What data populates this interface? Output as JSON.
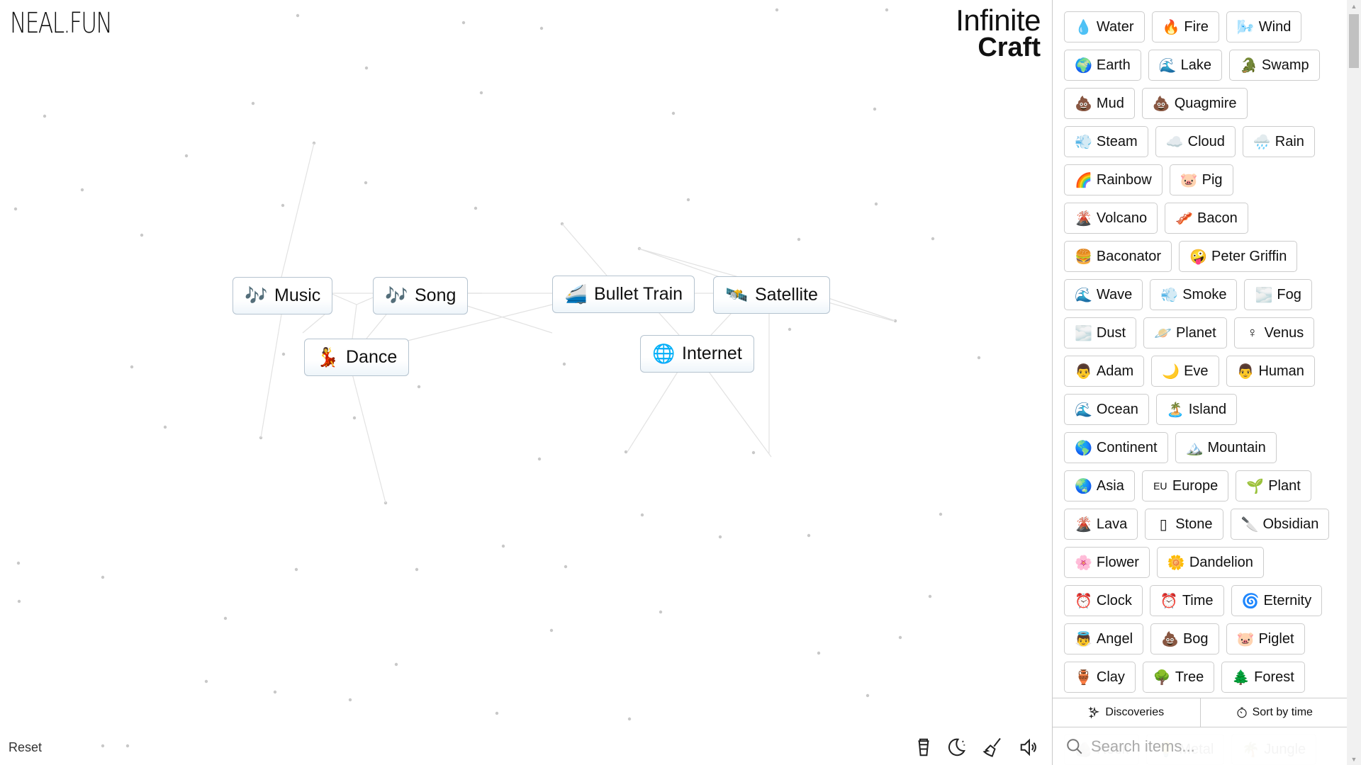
{
  "brand": {
    "logo": "NEAL.FUN",
    "title_line1": "Infinite",
    "title_line2": "Craft"
  },
  "canvas": {
    "instances": [
      {
        "label": "Music",
        "emoji": "🎶"
      },
      {
        "label": "Song",
        "emoji": "🎶"
      },
      {
        "label": "Dance",
        "emoji": "💃"
      },
      {
        "label": "Bullet Train",
        "emoji": "🚄"
      },
      {
        "label": "Satellite",
        "emoji": "🛰️"
      },
      {
        "label": "Internet",
        "emoji": "🌐"
      }
    ],
    "reset_label": "Reset",
    "tools": [
      {
        "name": "coffee-cup-icon"
      },
      {
        "name": "moon-icon"
      },
      {
        "name": "broom-icon"
      },
      {
        "name": "speaker-icon"
      }
    ]
  },
  "sidebar": {
    "items": [
      {
        "emoji": "💧",
        "label": "Water"
      },
      {
        "emoji": "🔥",
        "label": "Fire"
      },
      {
        "emoji": "🌬️",
        "label": "Wind"
      },
      {
        "emoji": "🌍",
        "label": "Earth"
      },
      {
        "emoji": "🌊",
        "label": "Lake"
      },
      {
        "emoji": "🐊",
        "label": "Swamp"
      },
      {
        "emoji": "💩",
        "label": "Mud"
      },
      {
        "emoji": "💩",
        "label": "Quagmire"
      },
      {
        "emoji": "💨",
        "label": "Steam"
      },
      {
        "emoji": "☁️",
        "label": "Cloud"
      },
      {
        "emoji": "🌧️",
        "label": "Rain"
      },
      {
        "emoji": "🌈",
        "label": "Rainbow"
      },
      {
        "emoji": "🐷",
        "label": "Pig"
      },
      {
        "emoji": "🌋",
        "label": "Volcano"
      },
      {
        "emoji": "🥓",
        "label": "Bacon"
      },
      {
        "emoji": "🍔",
        "label": "Baconator"
      },
      {
        "emoji": "🤪",
        "label": "Peter Griffin"
      },
      {
        "emoji": "🌊",
        "label": "Wave"
      },
      {
        "emoji": "💨",
        "label": "Smoke"
      },
      {
        "emoji": "🌫️",
        "label": "Fog"
      },
      {
        "emoji": "🌫️",
        "label": "Dust"
      },
      {
        "emoji": "🪐",
        "label": "Planet"
      },
      {
        "emoji": "♀",
        "label": "Venus"
      },
      {
        "emoji": "👨",
        "label": "Adam"
      },
      {
        "emoji": "🌙",
        "label": "Eve"
      },
      {
        "emoji": "👨",
        "label": "Human"
      },
      {
        "emoji": "🌊",
        "label": "Ocean"
      },
      {
        "emoji": "🏝️",
        "label": "Island"
      },
      {
        "emoji": "🌎",
        "label": "Continent"
      },
      {
        "emoji": "🏔️",
        "label": "Mountain"
      },
      {
        "emoji": "🌏",
        "label": "Asia"
      },
      {
        "emoji": "EU",
        "label": "Europe"
      },
      {
        "emoji": "🌱",
        "label": "Plant"
      },
      {
        "emoji": "🌋",
        "label": "Lava"
      },
      {
        "emoji": "▯",
        "label": "Stone"
      },
      {
        "emoji": "🔪",
        "label": "Obsidian"
      },
      {
        "emoji": "🌸",
        "label": "Flower"
      },
      {
        "emoji": "🌼",
        "label": "Dandelion"
      },
      {
        "emoji": "⏰",
        "label": "Clock"
      },
      {
        "emoji": "⏰",
        "label": "Time"
      },
      {
        "emoji": "🌀",
        "label": "Eternity"
      },
      {
        "emoji": "👼",
        "label": "Angel"
      },
      {
        "emoji": "💩",
        "label": "Bog"
      },
      {
        "emoji": "🐷",
        "label": "Piglet"
      },
      {
        "emoji": "🏺",
        "label": "Clay"
      },
      {
        "emoji": "🌳",
        "label": "Tree"
      },
      {
        "emoji": "🌲",
        "label": "Forest"
      }
    ],
    "hidden_items": [
      {
        "emoji": "🪨",
        "label": "Rock"
      },
      {
        "emoji": "💡",
        "label": "Metal"
      },
      {
        "emoji": "🌴",
        "label": "Jungle"
      }
    ],
    "discoveries_label": "Discoveries",
    "sort_label": "Sort by time",
    "search_placeholder": "Search items..."
  }
}
